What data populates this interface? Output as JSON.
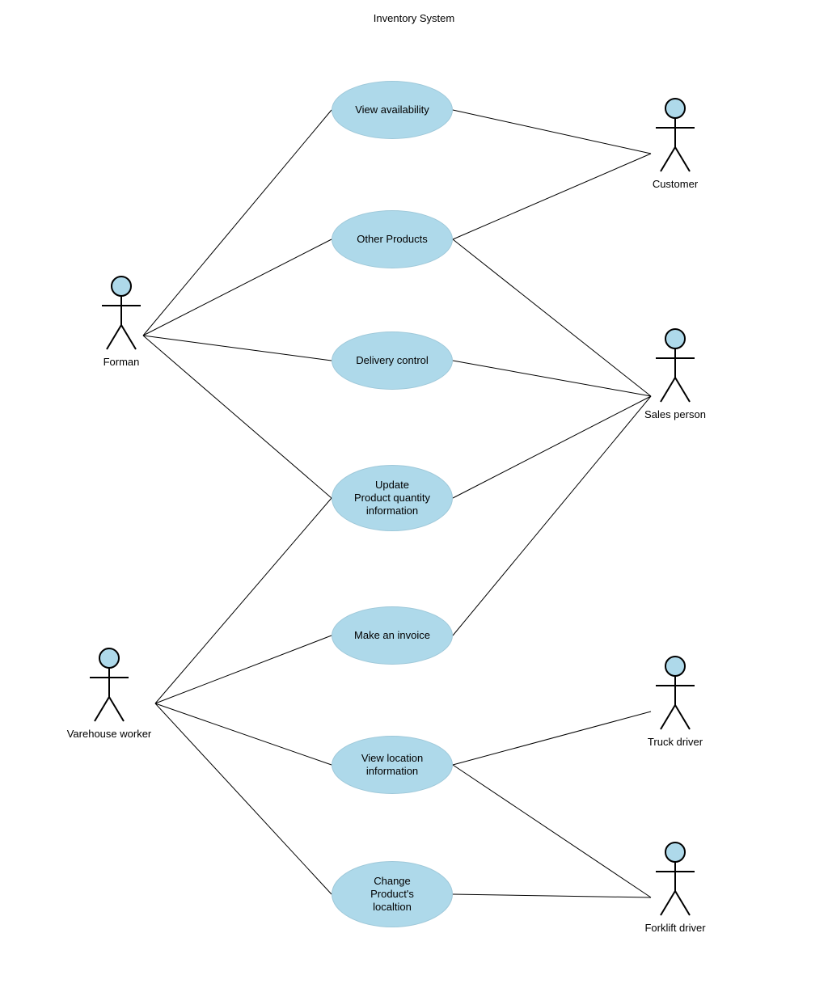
{
  "diagram": {
    "title": "Inventory System",
    "actors": {
      "forman": "Forman",
      "varehouse_worker": "Varehouse worker",
      "customer": "Customer",
      "sales_person": "Sales person",
      "truck_driver": "Truck driver",
      "forklift_driver": "Forklift driver"
    },
    "usecases": {
      "view_availability": "View availability",
      "other_products": "Other Products",
      "delivery_control": "Delivery control",
      "update_product_qty": "Update\nProduct quantity\ninformation",
      "make_invoice": "Make an invoice",
      "view_location": "View location\ninformation",
      "change_location": "Change\nProduct's\nlocaltion"
    }
  }
}
